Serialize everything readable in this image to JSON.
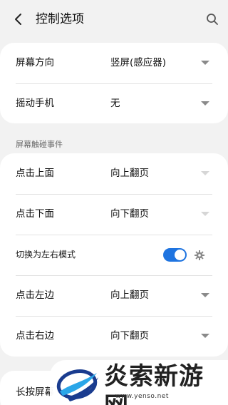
{
  "header": {
    "title": "控制选项"
  },
  "orientation": {
    "label": "屏幕方向",
    "value": "竖屏(感应器)"
  },
  "shake": {
    "label": "摇动手机",
    "value": "无"
  },
  "touch_section": {
    "title": "屏幕触碰事件"
  },
  "touch": {
    "top": {
      "label": "点击上面",
      "value": "向上翻页"
    },
    "bottom": {
      "label": "点击下面",
      "value": "向下翻页"
    },
    "left_right_mode": {
      "label": "切换为左右模式",
      "enabled": true
    },
    "left": {
      "label": "点击左边",
      "value": "向上翻页"
    },
    "right": {
      "label": "点击右边",
      "value": "向下翻页"
    }
  },
  "long_press": {
    "label": "长按屏幕"
  },
  "watermark": {
    "title": "炎索新游网",
    "url": "www.yenso.net"
  },
  "colors": {
    "accent": "#1f74e0",
    "background": "#f2f2f2",
    "card": "#ffffff"
  }
}
